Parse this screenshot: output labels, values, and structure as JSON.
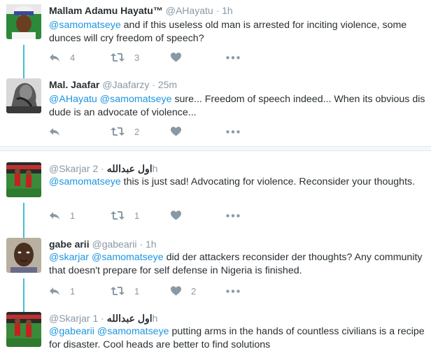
{
  "colors": {
    "thread_line": "#3ec1d3",
    "mention": "#1b95e0",
    "meta": "#8899a6",
    "text": "#292f33"
  },
  "tweets": [
    {
      "name": "Mallam Adamu Hayatu™",
      "handle": "@AHayatu",
      "dot": "·",
      "time": "1h",
      "mentions": [
        "@samomatseye"
      ],
      "body": " and if this useless old man is arrested for inciting violence, some dunces will cry freedom of speech?",
      "reply_count": "4",
      "retweet_count": "3",
      "like_count": ""
    },
    {
      "name": "Mal. Jaafar",
      "handle": "@Jaafarzy",
      "dot": "·",
      "time": "25m",
      "mentions": [
        "@AHayatu",
        "@samomatseye"
      ],
      "body": " sure... Freedom of speech indeed... When its obvious dis dude is an advocate of violence...",
      "reply_count": "",
      "retweet_count": "2",
      "like_count": ""
    },
    {
      "name": "اول عبدالله",
      "handle": "@Skarjar",
      "dot": "·",
      "time": "2h",
      "mentions": [
        "@samomatseye"
      ],
      "body": " this is just sad! Advocating for violence. Reconsider your thoughts.",
      "reply_count": "1",
      "retweet_count": "1",
      "like_count": ""
    },
    {
      "name": "gabe arii",
      "handle": "@gabearii",
      "dot": "·",
      "time": "1h",
      "mentions": [
        "@skarjar",
        "@samomatseye"
      ],
      "body": " did der attackers reconsider der thoughts? Any community that doesn't prepare for self defense in Nigeria is finished.",
      "reply_count": "1",
      "retweet_count": "1",
      "like_count": "2"
    },
    {
      "name": "اول عبدالله",
      "handle": "@Skarjar",
      "dot": "·",
      "time": "1h",
      "mentions": [
        "@gabearii",
        "@samomatseye"
      ],
      "body": " putting arms in the hands of countless civilians is a recipe for disaster. Cool heads are better to find solutions",
      "reply_count": "",
      "retweet_count": "",
      "like_count": ""
    }
  ]
}
